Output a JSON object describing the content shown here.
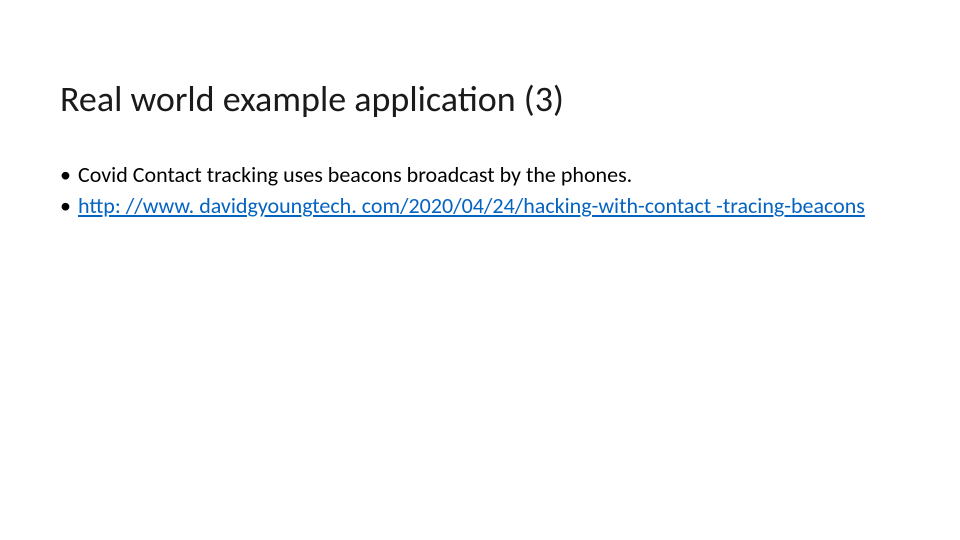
{
  "slide": {
    "title": "Real world example application (3)",
    "bullets": [
      {
        "type": "text",
        "text": "Covid Contact tracking uses beacons broadcast by the phones."
      },
      {
        "type": "link",
        "text": "http: //www. davidgyoungtech. com/2020/04/24/hacking-with-contact -tracing-beacons"
      }
    ]
  }
}
